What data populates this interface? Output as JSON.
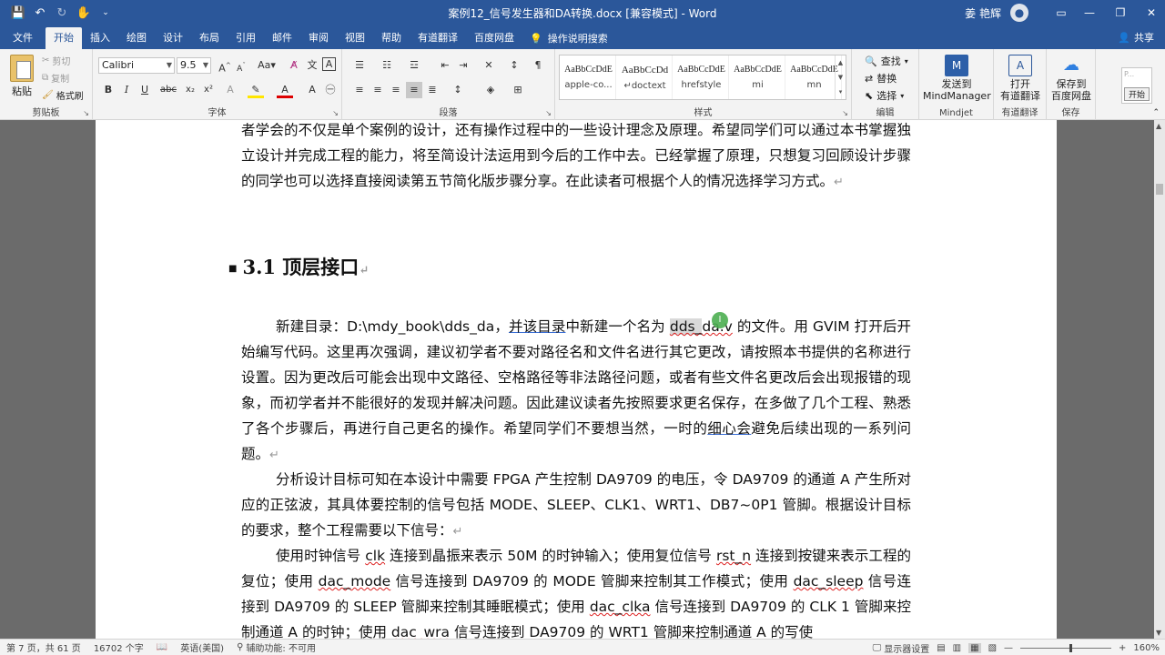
{
  "window": {
    "title": "案例12_信号发生器和DA转换.docx [兼容模式] - Word",
    "user_name": "姜 艳辉",
    "qat": {
      "save_icon": "save-icon",
      "undo_icon": "undo-icon",
      "redo_icon": "redo-icon",
      "touch_icon": "touch-mode-icon"
    }
  },
  "tabs": [
    {
      "label": "文件"
    },
    {
      "label": "开始"
    },
    {
      "label": "插入"
    },
    {
      "label": "绘图"
    },
    {
      "label": "设计"
    },
    {
      "label": "布局"
    },
    {
      "label": "引用"
    },
    {
      "label": "邮件"
    },
    {
      "label": "审阅"
    },
    {
      "label": "视图"
    },
    {
      "label": "帮助"
    },
    {
      "label": "有道翻译"
    },
    {
      "label": "百度网盘"
    }
  ],
  "tell_me": "操作说明搜索",
  "share": "共享",
  "ribbon": {
    "clipboard": {
      "paste": "粘贴",
      "cut": "剪切",
      "copy": "复制",
      "format_painter": "格式刷",
      "label": "剪贴板"
    },
    "font": {
      "name": "Calibri",
      "size": "9.5",
      "label": "字体"
    },
    "paragraph": {
      "label": "段落"
    },
    "styles": {
      "label": "样式",
      "items": [
        {
          "sample": "AaBbCcDdE",
          "name": "apple-co..."
        },
        {
          "sample": "AaBbCcDd",
          "name": "↵doctext"
        },
        {
          "sample": "AaBbCcDdE",
          "name": "hrefstyle"
        },
        {
          "sample": "AaBbCcDdE",
          "name": "mi"
        },
        {
          "sample": "AaBbCcDdE",
          "name": "mn"
        }
      ]
    },
    "editing": {
      "find": "查找",
      "replace": "替换",
      "select": "选择",
      "label": "编辑"
    },
    "mindjet": {
      "line1": "发送到",
      "line2": "MindManager",
      "label": "Mindjet"
    },
    "youdao": {
      "line1": "打开",
      "line2": "有道翻译",
      "label": "有道翻译"
    },
    "baidu": {
      "line1": "保存到",
      "line2": "百度网盘",
      "label": "保存"
    },
    "extra": {
      "start": "开始",
      "preview": "P..."
    }
  },
  "document": {
    "para1": "者学会的不仅是单个案例的设计，还有操作过程中的一些设计理念及原理。希望同学们可以通过本书掌握独立设计并完成工程的能力，将至简设计法运用到今后的工作中去。已经掌握了原理，只想复习回顾设计步骤的同学也可以选择直接阅读第五节简化版步骤分享。在此读者可根据个人的情况选择学习方式。",
    "heading": "3.1 顶层接口",
    "para2_a": "新建目录：D:\\mdy_book\\dds_da，",
    "para2_u1": "并该目录",
    "para2_b": "中新建一个名为 ",
    "para2_sel": "dds_",
    "para2_c": "da.v",
    "para2_d": " 的文件。用 GVIM 打开后开始编写代码。这里再次强调，建议初学者不要对路径名和文件名进行其它更改，请按照本书提供的名称进行设置。因为更改后可能会出现中文路径、空格路径等非法路径问题，或者有些文件名更改后会出现报错的现象，而初学者并不能很好的发现并解决问题。因此建议读者先按照要求更名保存，在多做了几个工程、熟悉了各个步骤后，再进行自己更名的操作。希望同学们不要想当然，一时的",
    "para2_u2": "细心会",
    "para2_e": "避免后续出现的一系列问题。",
    "para3": "分析设计目标可知在本设计中需要 FPGA 产生控制 DA9709 的电压，令 DA9709 的通道 A 产生所对应的正弦波，其具体要控制的信号包括 MODE、SLEEP、CLK1、WRT1、DB7~0P1 管脚。根据设计目标的要求，整个工程需要以下信号：",
    "para4_a": "使用时钟信号 ",
    "para4_clk": "clk",
    "para4_b": " 连接到晶振来表示 50M 的时钟输入；使用复位信号 ",
    "para4_rst": "rst_n",
    "para4_c": " 连接到按键来表示工程的复位；使用 ",
    "para4_mode": "dac_mode",
    "para4_d": " 信号连接到 DA9709 的 MODE 管脚来控制其工作模式；使用 ",
    "para4_sleep": "dac_sleep",
    "para4_e": " 信号连接到 DA9709 的 SLEEP 管脚来控制其睡眠模式；使用 ",
    "para4_clka": "dac_clka",
    "para4_f": " 信号连接到 DA9709 的 CLK 1 管脚来控制通道 A 的时钟；使用 ",
    "para4_wra": "dac_wra",
    "para4_g": " 信号连接到 DA9709 的 WRT1 管脚来控制通道 A 的写使",
    "para_mark": "↵"
  },
  "status": {
    "page": "第 7 页，共 61 页",
    "words": "16702 个字",
    "language": "英语(美国)",
    "accessibility": "辅助功能: 不可用",
    "display_settings": "显示器设置",
    "zoom": "160%"
  }
}
